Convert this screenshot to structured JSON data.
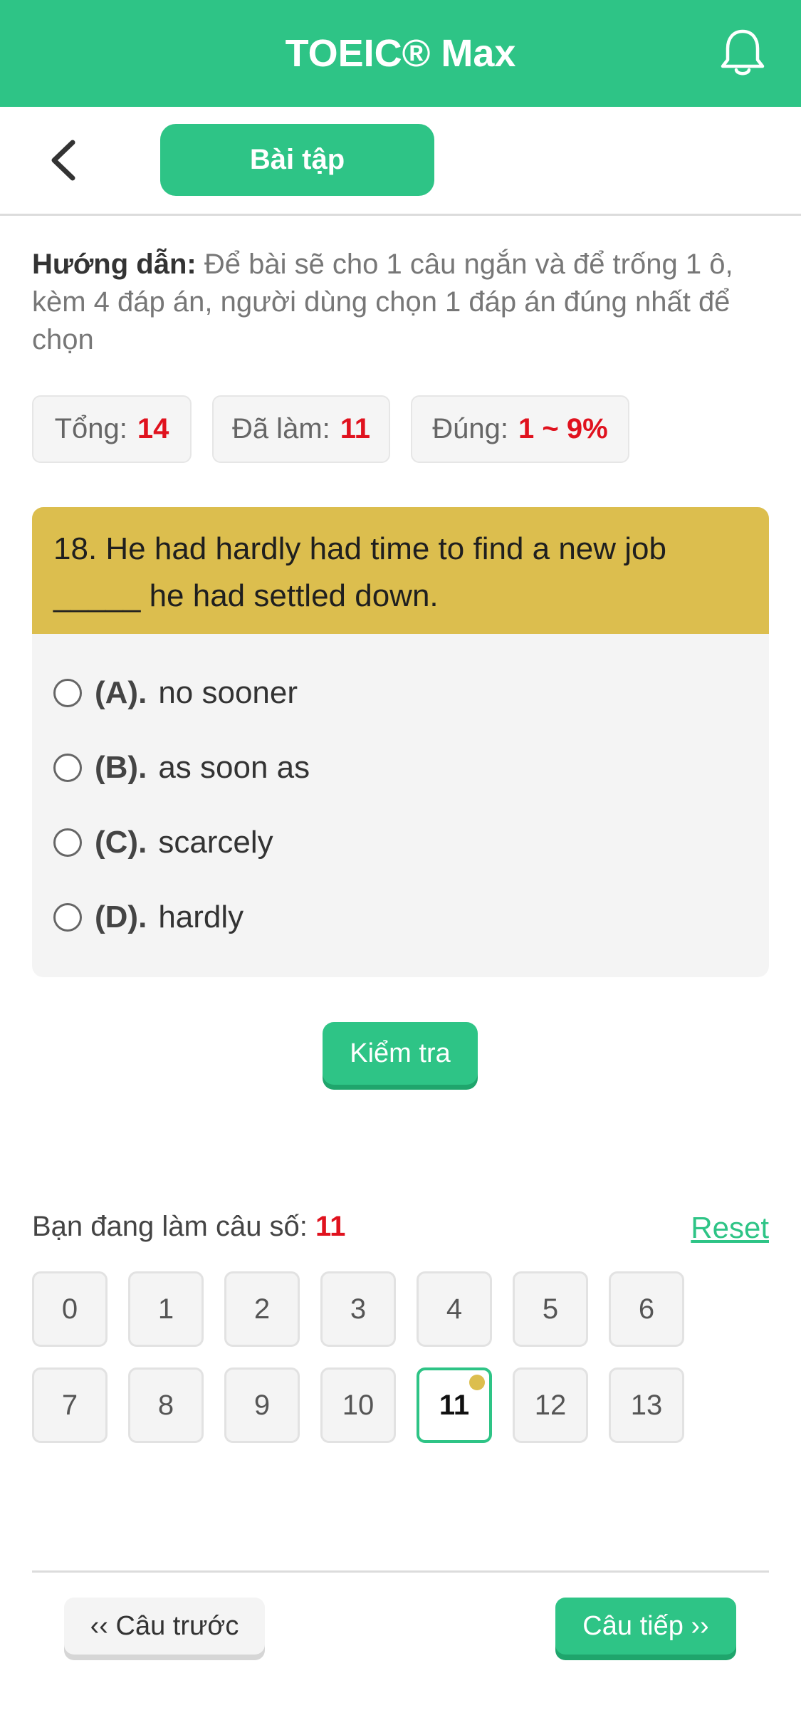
{
  "app": {
    "title": "TOEIC® Max"
  },
  "subbar": {
    "tab_label": "Bài tập"
  },
  "instruction": {
    "label": "Hướng dẫn:",
    "text": "Để bài sẽ cho 1 câu ngắn và để trống 1 ô, kèm 4 đáp án, người dùng chọn 1 đáp án đúng nhất để chọn"
  },
  "stats": [
    {
      "label": "Tổng:",
      "value": "14"
    },
    {
      "label": "Đã làm:",
      "value": "11"
    },
    {
      "label": "Đúng:",
      "value": "1 ~ 9%"
    }
  ],
  "question": {
    "text": "18. He had hardly had time to find a new job _____ he had settled down.",
    "options": [
      {
        "letter": "(A).",
        "text": "no sooner"
      },
      {
        "letter": "(B).",
        "text": "as soon as"
      },
      {
        "letter": "(C).",
        "text": "scarcely"
      },
      {
        "letter": "(D).",
        "text": "hardly"
      }
    ]
  },
  "check_button": "Kiểm tra",
  "progress": {
    "label": "Bạn đang làm câu số:",
    "current": "11",
    "reset": "Reset"
  },
  "numbers": [
    "0",
    "1",
    "2",
    "3",
    "4",
    "5",
    "6",
    "7",
    "8",
    "9",
    "10",
    "11",
    "12",
    "13"
  ],
  "current_index": 11,
  "nav": {
    "prev": "‹‹ Câu trước",
    "next": "Câu tiếp ››"
  },
  "colors": {
    "accent": "#2ec486",
    "question_header": "#dcbe4e",
    "value_red": "#e0121e"
  },
  "icons": {
    "notification": "bell-icon",
    "back": "chevron-left-icon"
  }
}
